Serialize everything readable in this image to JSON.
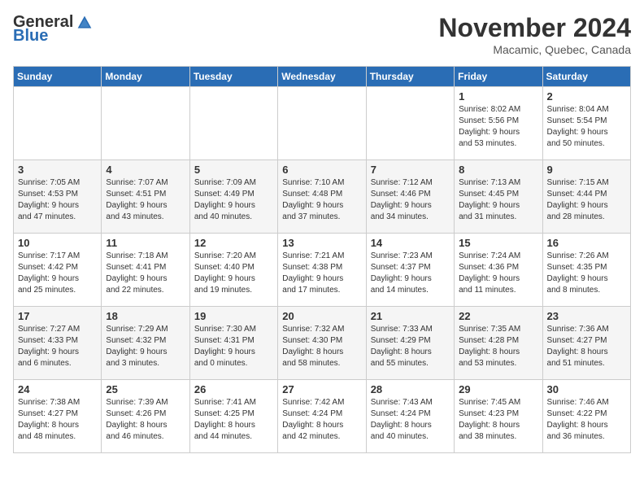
{
  "logo": {
    "general": "General",
    "blue": "Blue"
  },
  "header": {
    "month": "November 2024",
    "location": "Macamic, Quebec, Canada"
  },
  "days_of_week": [
    "Sunday",
    "Monday",
    "Tuesday",
    "Wednesday",
    "Thursday",
    "Friday",
    "Saturday"
  ],
  "weeks": [
    [
      {
        "day": "",
        "info": ""
      },
      {
        "day": "",
        "info": ""
      },
      {
        "day": "",
        "info": ""
      },
      {
        "day": "",
        "info": ""
      },
      {
        "day": "",
        "info": ""
      },
      {
        "day": "1",
        "info": "Sunrise: 8:02 AM\nSunset: 5:56 PM\nDaylight: 9 hours\nand 53 minutes."
      },
      {
        "day": "2",
        "info": "Sunrise: 8:04 AM\nSunset: 5:54 PM\nDaylight: 9 hours\nand 50 minutes."
      }
    ],
    [
      {
        "day": "3",
        "info": "Sunrise: 7:05 AM\nSunset: 4:53 PM\nDaylight: 9 hours\nand 47 minutes."
      },
      {
        "day": "4",
        "info": "Sunrise: 7:07 AM\nSunset: 4:51 PM\nDaylight: 9 hours\nand 43 minutes."
      },
      {
        "day": "5",
        "info": "Sunrise: 7:09 AM\nSunset: 4:49 PM\nDaylight: 9 hours\nand 40 minutes."
      },
      {
        "day": "6",
        "info": "Sunrise: 7:10 AM\nSunset: 4:48 PM\nDaylight: 9 hours\nand 37 minutes."
      },
      {
        "day": "7",
        "info": "Sunrise: 7:12 AM\nSunset: 4:46 PM\nDaylight: 9 hours\nand 34 minutes."
      },
      {
        "day": "8",
        "info": "Sunrise: 7:13 AM\nSunset: 4:45 PM\nDaylight: 9 hours\nand 31 minutes."
      },
      {
        "day": "9",
        "info": "Sunrise: 7:15 AM\nSunset: 4:44 PM\nDaylight: 9 hours\nand 28 minutes."
      }
    ],
    [
      {
        "day": "10",
        "info": "Sunrise: 7:17 AM\nSunset: 4:42 PM\nDaylight: 9 hours\nand 25 minutes."
      },
      {
        "day": "11",
        "info": "Sunrise: 7:18 AM\nSunset: 4:41 PM\nDaylight: 9 hours\nand 22 minutes."
      },
      {
        "day": "12",
        "info": "Sunrise: 7:20 AM\nSunset: 4:40 PM\nDaylight: 9 hours\nand 19 minutes."
      },
      {
        "day": "13",
        "info": "Sunrise: 7:21 AM\nSunset: 4:38 PM\nDaylight: 9 hours\nand 17 minutes."
      },
      {
        "day": "14",
        "info": "Sunrise: 7:23 AM\nSunset: 4:37 PM\nDaylight: 9 hours\nand 14 minutes."
      },
      {
        "day": "15",
        "info": "Sunrise: 7:24 AM\nSunset: 4:36 PM\nDaylight: 9 hours\nand 11 minutes."
      },
      {
        "day": "16",
        "info": "Sunrise: 7:26 AM\nSunset: 4:35 PM\nDaylight: 9 hours\nand 8 minutes."
      }
    ],
    [
      {
        "day": "17",
        "info": "Sunrise: 7:27 AM\nSunset: 4:33 PM\nDaylight: 9 hours\nand 6 minutes."
      },
      {
        "day": "18",
        "info": "Sunrise: 7:29 AM\nSunset: 4:32 PM\nDaylight: 9 hours\nand 3 minutes."
      },
      {
        "day": "19",
        "info": "Sunrise: 7:30 AM\nSunset: 4:31 PM\nDaylight: 9 hours\nand 0 minutes."
      },
      {
        "day": "20",
        "info": "Sunrise: 7:32 AM\nSunset: 4:30 PM\nDaylight: 8 hours\nand 58 minutes."
      },
      {
        "day": "21",
        "info": "Sunrise: 7:33 AM\nSunset: 4:29 PM\nDaylight: 8 hours\nand 55 minutes."
      },
      {
        "day": "22",
        "info": "Sunrise: 7:35 AM\nSunset: 4:28 PM\nDaylight: 8 hours\nand 53 minutes."
      },
      {
        "day": "23",
        "info": "Sunrise: 7:36 AM\nSunset: 4:27 PM\nDaylight: 8 hours\nand 51 minutes."
      }
    ],
    [
      {
        "day": "24",
        "info": "Sunrise: 7:38 AM\nSunset: 4:27 PM\nDaylight: 8 hours\nand 48 minutes."
      },
      {
        "day": "25",
        "info": "Sunrise: 7:39 AM\nSunset: 4:26 PM\nDaylight: 8 hours\nand 46 minutes."
      },
      {
        "day": "26",
        "info": "Sunrise: 7:41 AM\nSunset: 4:25 PM\nDaylight: 8 hours\nand 44 minutes."
      },
      {
        "day": "27",
        "info": "Sunrise: 7:42 AM\nSunset: 4:24 PM\nDaylight: 8 hours\nand 42 minutes."
      },
      {
        "day": "28",
        "info": "Sunrise: 7:43 AM\nSunset: 4:24 PM\nDaylight: 8 hours\nand 40 minutes."
      },
      {
        "day": "29",
        "info": "Sunrise: 7:45 AM\nSunset: 4:23 PM\nDaylight: 8 hours\nand 38 minutes."
      },
      {
        "day": "30",
        "info": "Sunrise: 7:46 AM\nSunset: 4:22 PM\nDaylight: 8 hours\nand 36 minutes."
      }
    ]
  ]
}
